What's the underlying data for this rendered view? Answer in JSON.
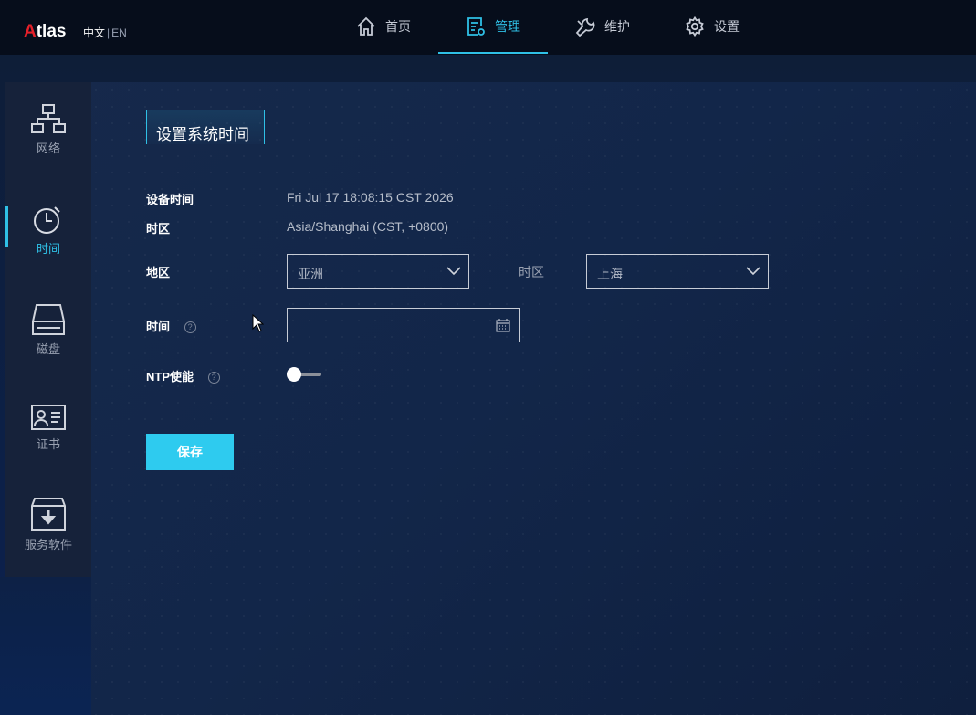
{
  "header": {
    "logo_a": "A",
    "logo_rest": "tlas",
    "lang_zh": "中文",
    "lang_sep": "|",
    "lang_en": "EN",
    "nav": [
      {
        "label": "首页",
        "icon": "home-icon"
      },
      {
        "label": "管理",
        "icon": "manage-icon",
        "active": true
      },
      {
        "label": "维护",
        "icon": "wrench-icon"
      },
      {
        "label": "设置",
        "icon": "gear-icon"
      }
    ]
  },
  "sidebar": {
    "items": [
      {
        "label": "网络",
        "icon": "network-icon"
      },
      {
        "label": "时间",
        "icon": "stopwatch-icon",
        "active": true
      },
      {
        "label": "磁盘",
        "icon": "disk-icon"
      },
      {
        "label": "证书",
        "icon": "certificate-icon"
      },
      {
        "label": "服务软件",
        "icon": "download-box-icon"
      }
    ]
  },
  "main": {
    "section_title": "设置系统时间",
    "device_time_label": "设备时间",
    "device_time_value": "Fri Jul 17 18:08:15 CST 2026",
    "timezone_label": "时区",
    "timezone_value": "Asia/Shanghai (CST, +0800)",
    "region_label": "地区",
    "region_value": "亚洲",
    "tz_select_label": "时区",
    "tz_select_value": "上海",
    "time_label": "时间",
    "time_help": "?",
    "time_value": "",
    "ntp_label": "NTP使能",
    "ntp_help": "?",
    "ntp_enabled": false,
    "save_label": "保存"
  },
  "colors": {
    "accent": "#2fc0e6",
    "button": "#2ecbef",
    "logo_red": "#e5202a"
  }
}
